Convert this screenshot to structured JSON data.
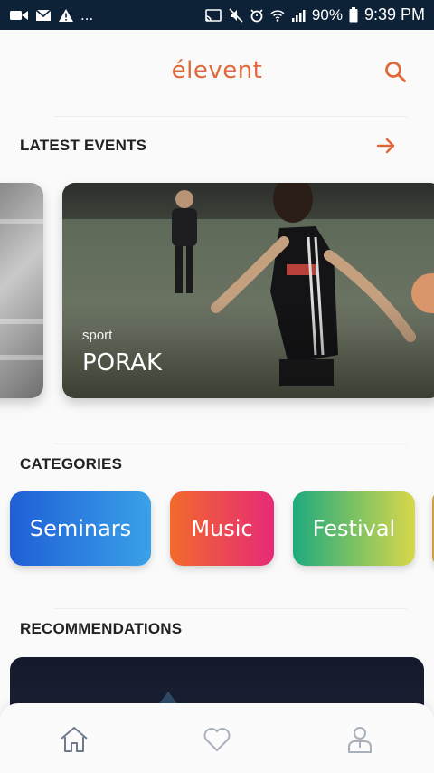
{
  "status_bar": {
    "battery": "90%",
    "time": "9:39 PM",
    "notif_dots": "..."
  },
  "app": {
    "logo": "élevent"
  },
  "latest_events": {
    "title": "LATEST EVENTS",
    "featured": {
      "category": "sport",
      "name": "PORAK"
    }
  },
  "categories": {
    "title": "CATEGORIES",
    "items": [
      "Seminars",
      "Music",
      "Festival"
    ]
  },
  "recommendations": {
    "title": "RECOMMENDATIONS"
  },
  "colors": {
    "accent": "#e0683a",
    "status_bar": "#0e2237",
    "nav_icon": "#7a8696"
  },
  "nav": {
    "items": [
      "home-icon",
      "heart-icon",
      "profile-icon"
    ]
  }
}
